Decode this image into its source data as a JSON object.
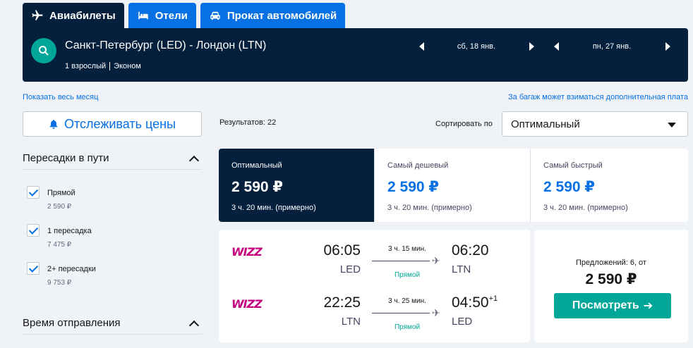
{
  "tabs": [
    {
      "label": "Авиабилеты",
      "icon": "plane-icon",
      "active": true
    },
    {
      "label": "Отели",
      "icon": "bed-icon",
      "active": false
    },
    {
      "label": "Прокат автомобилей",
      "icon": "car-icon",
      "active": false
    }
  ],
  "search": {
    "route": "Санкт-Петербург (LED) - Лондон (LTN)",
    "passengers": "1 взрослый",
    "cabin": "Эконом",
    "depart_date": "сб, 18 янв.",
    "return_date": "пн, 27 янв."
  },
  "links": {
    "show_month": "Показать весь месяц",
    "baggage_note": "За багаж может взиматься дополнительная плата"
  },
  "sidebar": {
    "track_label": "Отслеживать цены",
    "stops_title": "Пересадки в пути",
    "stops": [
      {
        "label": "Прямой",
        "price": "2 590 ₽",
        "checked": true
      },
      {
        "label": "1 пересадка",
        "price": "7 475 ₽",
        "checked": true
      },
      {
        "label": "2+ пересадки",
        "price": "9 753 ₽",
        "checked": true
      }
    ],
    "departure_title": "Время отправления"
  },
  "results": {
    "count": "Результатов: 22",
    "sort_label": "Сортировать по",
    "sort_value": "Оптимальный"
  },
  "sort_tabs": [
    {
      "name": "Оптимальный",
      "price": "2 590 ₽",
      "duration": "3 ч. 20 мин. (примерно)",
      "active": true
    },
    {
      "name": "Самый дешевый",
      "price": "2 590 ₽",
      "duration": "3 ч. 20 мин. (примерно)",
      "active": false
    },
    {
      "name": "Самый быстрый",
      "price": "2 590 ₽",
      "duration": "3 ч. 20 мин. (примерно)",
      "active": false
    }
  ],
  "itinerary": {
    "legs": [
      {
        "airline": "WIZZ",
        "dep_time": "06:05",
        "dep_code": "LED",
        "duration": "3 ч. 15 мин.",
        "stops": "Прямой",
        "arr_time": "06:20",
        "arr_code": "LTN",
        "day_offset": ""
      },
      {
        "airline": "WIZZ",
        "dep_time": "22:25",
        "dep_code": "LTN",
        "duration": "3 ч. 25 мин.",
        "stops": "Прямой",
        "arr_time": "04:50",
        "arr_code": "LED",
        "day_offset": "+1"
      }
    ],
    "offers": "Предложений: 6, от",
    "price": "2 590 ₽",
    "view_label": "Посмотреть"
  },
  "colors": {
    "navy": "#05203c",
    "blue": "#0770e3",
    "teal": "#00a698"
  }
}
